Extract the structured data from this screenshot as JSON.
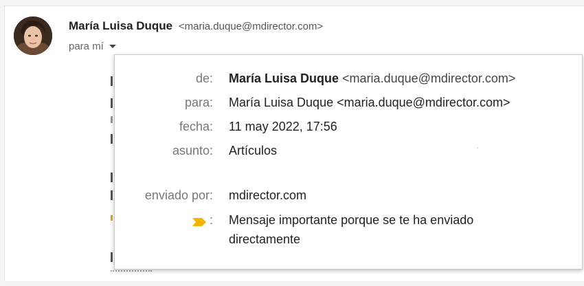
{
  "sender": {
    "name": "María Luisa Duque",
    "email": "<maria.duque@mdirector.com>"
  },
  "recipient_toggle": {
    "label": "para mí"
  },
  "icons": {
    "avatar": "user-photo",
    "caret": "chevron-down-icon",
    "important": "important-marker-icon"
  },
  "colors": {
    "important_marker": "#f4b400",
    "label_gray": "#777777",
    "popup_border": "#c8c8c8"
  },
  "details": {
    "from": {
      "label": "de:",
      "name": "María Luisa Duque",
      "email": "<maria.duque@mdirector.com>"
    },
    "to": {
      "label": "para:",
      "value": "María Luisa Duque <maria.duque@mdirector.com>"
    },
    "date": {
      "label": "fecha:",
      "value": "11 may 2022, 17:56"
    },
    "subject": {
      "label": "asunto:",
      "value": "Artículos"
    },
    "sent_by": {
      "label": "enviado por:",
      "value": "mdirector.com"
    },
    "importance": {
      "colon": ":",
      "value": "Mensaje importante porque se te ha enviado directamente"
    }
  }
}
